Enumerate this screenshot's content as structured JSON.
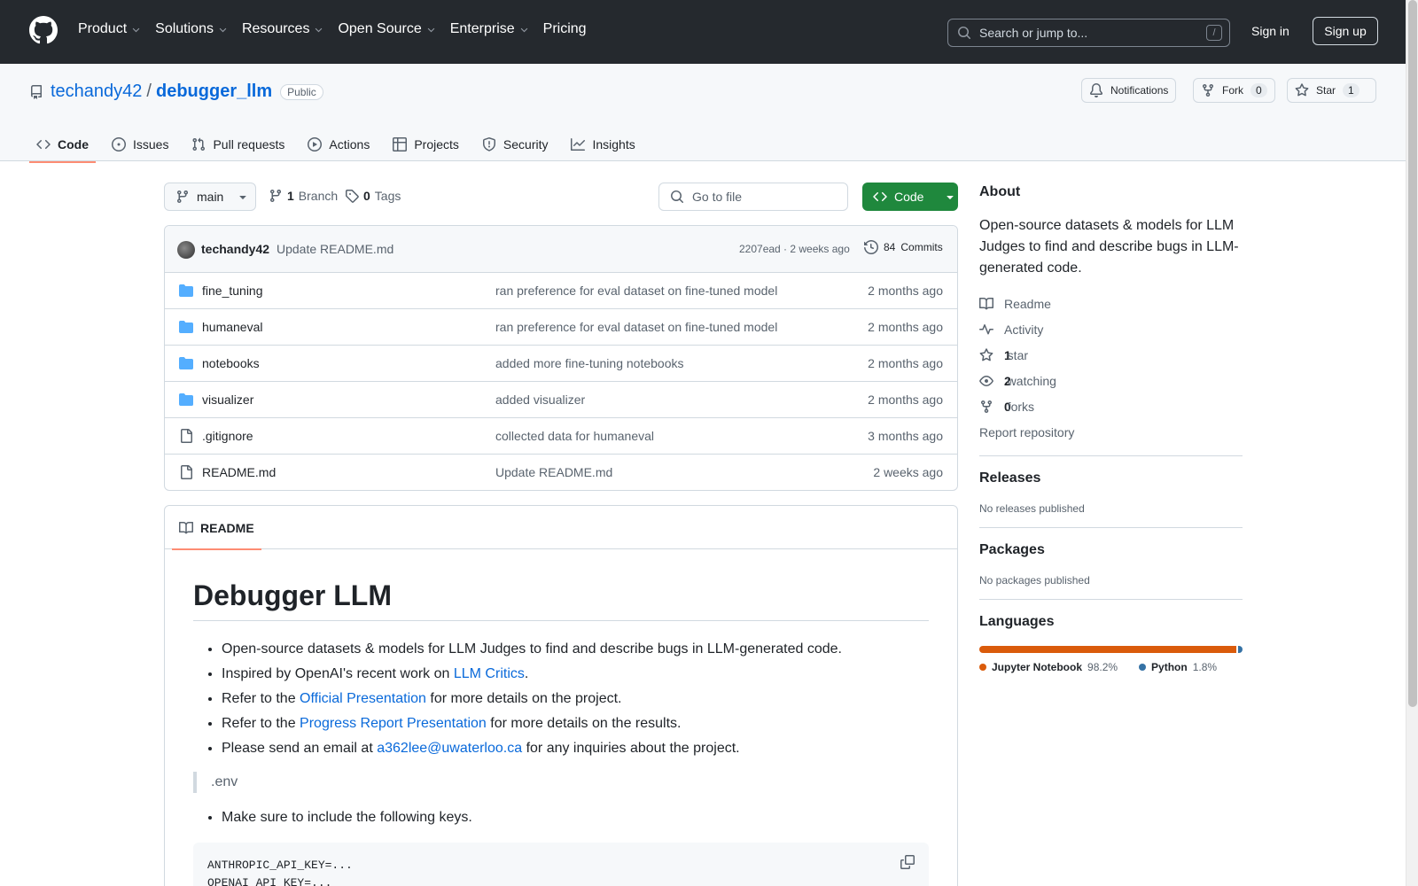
{
  "header": {
    "nav": [
      {
        "label": "Product",
        "has_caret": true
      },
      {
        "label": "Solutions",
        "has_caret": true
      },
      {
        "label": "Resources",
        "has_caret": true
      },
      {
        "label": "Open Source",
        "has_caret": true
      },
      {
        "label": "Enterprise",
        "has_caret": true
      },
      {
        "label": "Pricing",
        "has_caret": false
      }
    ],
    "search_placeholder": "Search or jump to...",
    "search_shortcut": "/",
    "sign_in": "Sign in",
    "sign_up": "Sign up"
  },
  "repo": {
    "owner": "techandy42",
    "separator": "/",
    "name": "debugger_llm",
    "visibility": "Public",
    "notifications_label": "Notifications",
    "fork_label": "Fork",
    "fork_count": "0",
    "star_label": "Star",
    "star_count": "1",
    "tabs": [
      {
        "label": "Code",
        "icon": "code-icon",
        "active": true
      },
      {
        "label": "Issues",
        "icon": "issue-icon",
        "active": false
      },
      {
        "label": "Pull requests",
        "icon": "pull-request-icon",
        "active": false
      },
      {
        "label": "Actions",
        "icon": "play-icon",
        "active": false
      },
      {
        "label": "Projects",
        "icon": "table-icon",
        "active": false
      },
      {
        "label": "Security",
        "icon": "shield-icon",
        "active": false
      },
      {
        "label": "Insights",
        "icon": "graph-icon",
        "active": false
      }
    ]
  },
  "toolbar": {
    "branch": "main",
    "branch_count": "1",
    "branch_label": "Branch",
    "tag_count": "0",
    "tag_label": "Tags",
    "goto_file": "Go to file",
    "code_button": "Code"
  },
  "latest_commit": {
    "author": "techandy42",
    "message": "Update README.md",
    "sha_time": "2207ead · 2 weeks ago",
    "commits_count": "84",
    "commits_label": "Commits"
  },
  "files": [
    {
      "name": "fine_tuning",
      "type": "folder",
      "message": "ran preference for eval dataset on fine-tuned model",
      "date": "2 months ago"
    },
    {
      "name": "humaneval",
      "type": "folder",
      "message": "ran preference for eval dataset on fine-tuned model",
      "date": "2 months ago"
    },
    {
      "name": "notebooks",
      "type": "folder",
      "message": "added more fine-tuning notebooks",
      "date": "2 months ago"
    },
    {
      "name": "visualizer",
      "type": "folder",
      "message": "added visualizer",
      "date": "2 months ago"
    },
    {
      "name": ".gitignore",
      "type": "file",
      "message": "collected data for humaneval",
      "date": "3 months ago"
    },
    {
      "name": "README.md",
      "type": "file",
      "message": "Update README.md",
      "date": "2 weeks ago"
    }
  ],
  "readme": {
    "tab_label": "README",
    "title": "Debugger LLM",
    "bullets": [
      {
        "before": "Open-source datasets & models for LLM Judges to find and describe bugs in LLM-generated code.",
        "link": "",
        "after": ""
      },
      {
        "before": "Inspired by OpenAI's recent work on ",
        "link": "LLM Critics",
        "after": "."
      },
      {
        "before": "Refer to the ",
        "link": "Official Presentation",
        "after": " for more details on the project."
      },
      {
        "before": "Refer to the ",
        "link": "Progress Report Presentation",
        "after": " for more details on the results."
      },
      {
        "before": "Please send an email at ",
        "link": "a362lee@uwaterloo.ca",
        "after": " for any inquiries about the project."
      }
    ],
    "quote": ".env",
    "bullets2": [
      "Make sure to include the following keys."
    ],
    "code_lines": [
      "ANTHROPIC_API_KEY=...",
      "OPENAI_API_KEY=..."
    ]
  },
  "sidebar": {
    "about_heading": "About",
    "about_text": "Open-source datasets & models for LLM Judges to find and describe bugs in LLM-generated code.",
    "links": [
      {
        "icon": "book-icon",
        "bold": "",
        "label": "Readme"
      },
      {
        "icon": "pulse-icon",
        "bold": "",
        "label": "Activity"
      },
      {
        "icon": "star-icon",
        "bold": "1",
        "label": " star"
      },
      {
        "icon": "eye-icon",
        "bold": "2",
        "label": " watching"
      },
      {
        "icon": "fork-icon",
        "bold": "0",
        "label": " forks"
      }
    ],
    "report": "Report repository",
    "releases_heading": "Releases",
    "releases_text": "No releases published",
    "packages_heading": "Packages",
    "packages_text": "No packages published",
    "languages_heading": "Languages",
    "languages": [
      {
        "name": "Jupyter Notebook",
        "percent": "98.2%",
        "value": 98.2,
        "color": "#DA5B0B"
      },
      {
        "name": "Python",
        "percent": "1.8%",
        "value": 1.8,
        "color": "#3572A5"
      }
    ]
  }
}
